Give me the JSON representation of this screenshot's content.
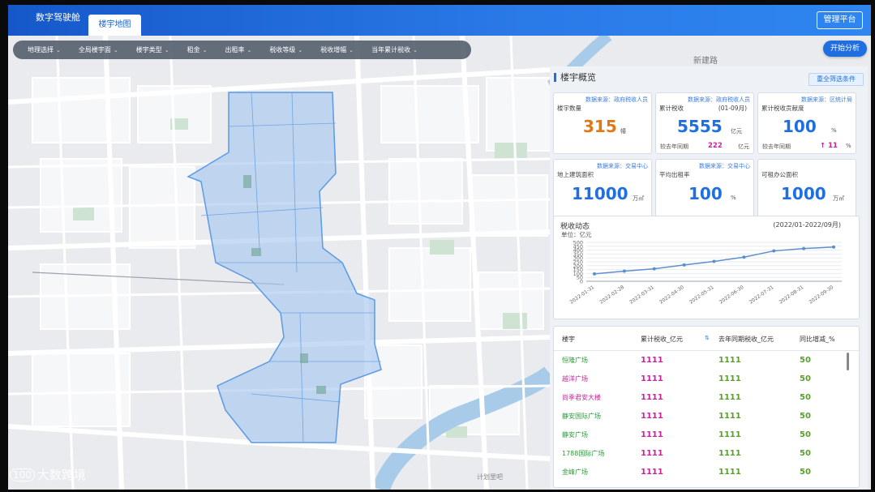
{
  "header": {
    "app_title": "数字驾驶舱",
    "active_tab": "楼宇地图",
    "admin_button": "管理平台"
  },
  "filters": [
    {
      "label": "地理选择"
    },
    {
      "label": "全局楼宇面"
    },
    {
      "label": "楼宇类型"
    },
    {
      "label": "租金"
    },
    {
      "label": "出租率"
    },
    {
      "label": "税收等级"
    },
    {
      "label": "税收增幅"
    },
    {
      "label": "当年累计税收"
    }
  ],
  "start_button": "开始分析",
  "map": {
    "road_label": "新建路",
    "road_label_2": "计划里吧"
  },
  "overview": {
    "title": "楼宇概览",
    "reset_button": "重全筛选条件",
    "cards": [
      {
        "source": "数据来源：政府税收人员",
        "label": "楼宇数量",
        "value": "315",
        "unit": "幢",
        "value_color": "#e07818"
      },
      {
        "source": "数据来源：政府税收人员",
        "label": "累计税收",
        "period": "(01-09月)",
        "value": "5555",
        "unit": "亿元",
        "compare_label": "较去年同期",
        "compare_value": "222",
        "compare_unit": "亿元"
      },
      {
        "source": "数据来源：区统计局",
        "label": "累计税收贡献度",
        "period": "(01-09月)",
        "value": "100",
        "unit": "%",
        "compare_label": "较去年同期",
        "compare_value": "↑ 11",
        "compare_unit": "%"
      },
      {
        "source": "数据来源：交易中心",
        "label": "地上建筑面积",
        "value": "11000",
        "unit": "万㎡"
      },
      {
        "source": "数据来源：交易中心",
        "label": "平均出租率",
        "value": "100",
        "unit": "%"
      },
      {
        "label": "可租办公面积",
        "value": "1000",
        "unit": "万㎡"
      }
    ]
  },
  "tax_chart_panel": {
    "title": "税收动态",
    "range": "(2022/01-2022/09月)",
    "unit": "单位：亿元"
  },
  "chart_data": {
    "type": "line",
    "title": "税收动态",
    "ylabel": "单位：亿元",
    "categories": [
      "2022-01-31",
      "2022-02-28",
      "2022-03-31",
      "2022-04-30",
      "2022-05-31",
      "2022-06-30",
      "2022-07-31",
      "2022-08-31",
      "2022-09-30"
    ],
    "series": [
      {
        "values": [
          95,
          130,
          160,
          210,
          255,
          310,
          390,
          420,
          440
        ]
      }
    ],
    "yticks": [
      0,
      50,
      100,
      150,
      200,
      250,
      300,
      350,
      400,
      450,
      500
    ],
    "ylim": [
      0,
      500
    ],
    "grid": true,
    "color": "#5b8fd0"
  },
  "table": {
    "headers": [
      "楼宇",
      "累计税收_亿元",
      "去年同期税收_亿元",
      "同比增减_%"
    ],
    "sort_icon": "sort-icon",
    "rows": [
      {
        "name": "恒隆广场",
        "tax": "1111",
        "last_year": "1111",
        "yoy": "50",
        "name_color": "green"
      },
      {
        "name": "越洋广场",
        "tax": "1111",
        "last_year": "1111",
        "yoy": "50",
        "name_color": "pink"
      },
      {
        "name": "尚季君安大楼",
        "tax": "1111",
        "last_year": "1111",
        "yoy": "50",
        "name_color": "pink"
      },
      {
        "name": "静安国际广场",
        "tax": "1111",
        "last_year": "1111",
        "yoy": "50",
        "name_color": "green"
      },
      {
        "name": "静安广场",
        "tax": "1111",
        "last_year": "1111",
        "yoy": "50",
        "name_color": "green"
      },
      {
        "name": "1788国际广场",
        "tax": "1111",
        "last_year": "1111",
        "yoy": "50",
        "name_color": "green"
      },
      {
        "name": "金峰广场",
        "tax": "1111",
        "last_year": "1111",
        "yoy": "50",
        "name_color": "green"
      }
    ]
  },
  "watermark": {
    "logo": "100",
    "text": "大数跨境"
  }
}
